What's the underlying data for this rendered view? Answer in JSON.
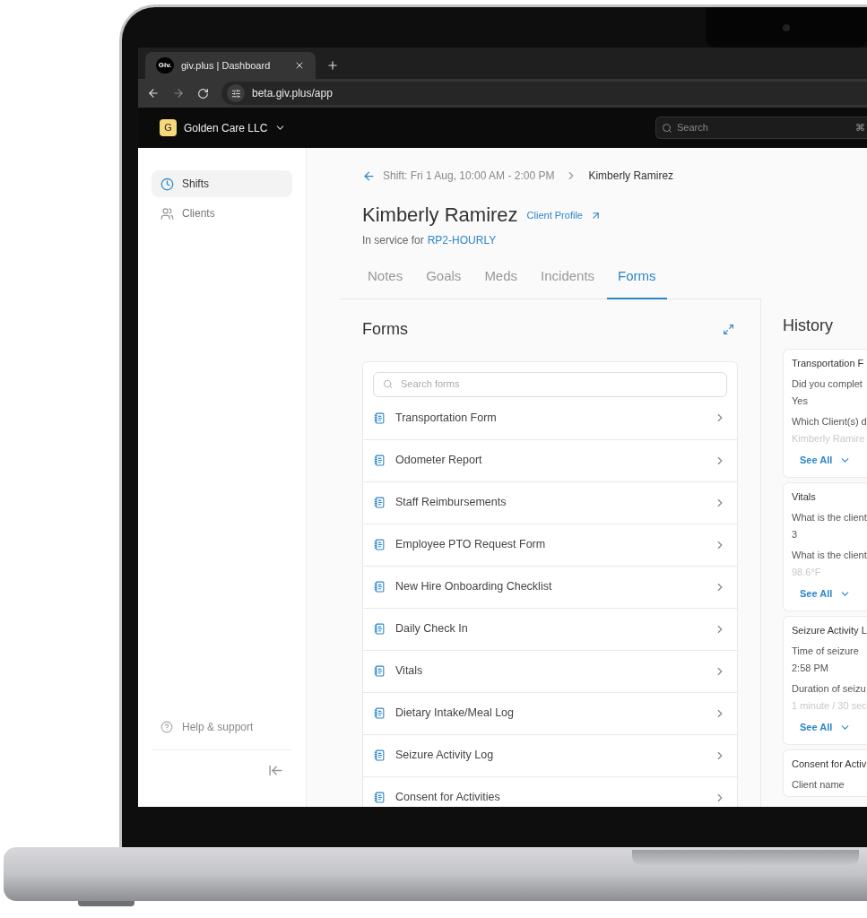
{
  "browser": {
    "favicon": "Giv.",
    "tab_title": "giv.plus | Dashboard",
    "url": "beta.giv.plus/app"
  },
  "header": {
    "org_initial": "G",
    "org_name": "Golden Care LLC",
    "search_placeholder": "Search",
    "shortcut": "⌘"
  },
  "sidebar": {
    "items": [
      {
        "label": "Shifts",
        "selected": true
      },
      {
        "label": "Clients",
        "selected": false
      }
    ],
    "footer_link": "Help & support"
  },
  "breadcrumb": {
    "parent": "Shift: Fri 1 Aug, 10:00 AM - 2:00 PM",
    "current": "Kimberly Ramirez"
  },
  "client": {
    "name": "Kimberly Ramirez",
    "profile_link": "Client Profile",
    "service_prefix": "In service for",
    "service": "RP2-HOURLY"
  },
  "tabs": [
    {
      "label": "Notes",
      "selected": false
    },
    {
      "label": "Goals",
      "selected": false
    },
    {
      "label": "Meds",
      "selected": false
    },
    {
      "label": "Incidents",
      "selected": false
    },
    {
      "label": "Forms",
      "selected": true
    }
  ],
  "forms": {
    "title": "Forms",
    "search_placeholder": "Search forms",
    "items": [
      "Transportation Form",
      "Odometer Report",
      "Staff Reimbursements",
      "Employee PTO Request Form",
      "New Hire Onboarding Checklist",
      "Daily Check In",
      "Vitals",
      "Dietary Intake/Meal Log",
      "Seizure Activity Log",
      "Consent for Activities"
    ]
  },
  "history": {
    "title": "History",
    "cards": [
      {
        "title": "Transportation F",
        "fields": [
          {
            "question": "Did you complet",
            "answer": "Yes",
            "faded": false
          },
          {
            "question": "Which Client(s) d",
            "answer": "Kimberly Ramire",
            "faded": true
          }
        ],
        "see_all": "See All"
      },
      {
        "title": "Vitals",
        "fields": [
          {
            "question": "What is the client",
            "answer": "3",
            "faded": false
          },
          {
            "question": "What is the client",
            "answer": "98.6°F",
            "faded": true
          }
        ],
        "see_all": "See All"
      },
      {
        "title": "Seizure Activity L",
        "fields": [
          {
            "question": "Time of seizure",
            "answer": "2:58 PM",
            "faded": false
          },
          {
            "question": "Duration of seizu",
            "answer": "1 minute / 30 sec",
            "faded": true
          }
        ],
        "see_all": "See All"
      },
      {
        "title": "Consent for Activ",
        "fields": [
          {
            "question": "Client name"
          }
        ]
      }
    ]
  }
}
